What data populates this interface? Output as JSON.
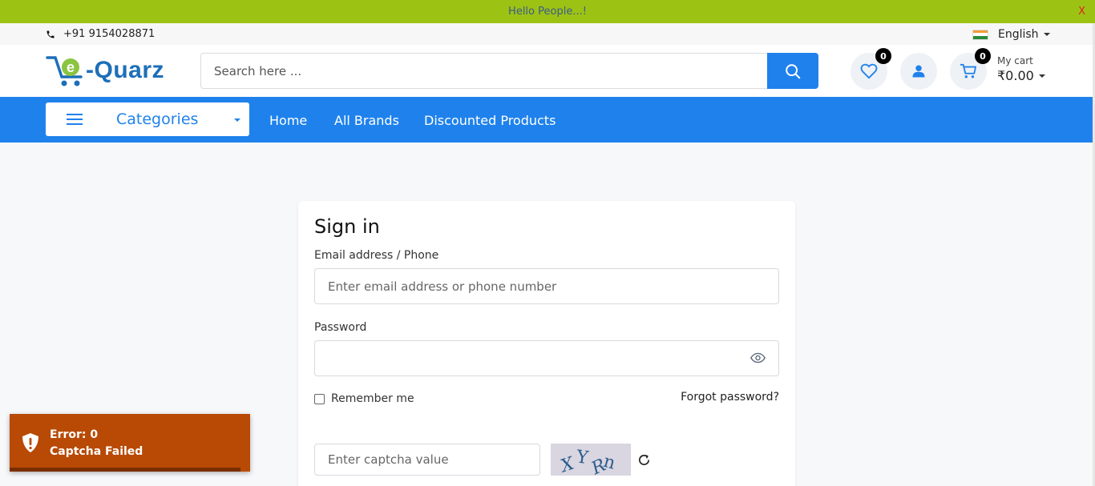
{
  "announcement": {
    "text": "Hello People...!",
    "close": "X"
  },
  "topbar": {
    "phone": "+91 9154028871",
    "language": "English"
  },
  "header": {
    "logo": {
      "text": "-Quarz",
      "letter": "e"
    },
    "search": {
      "placeholder": "Search here ..."
    },
    "wishlist": {
      "count": "0"
    },
    "cart": {
      "count": "0",
      "label": "My cart",
      "amount": "₹0.00"
    }
  },
  "nav": {
    "categories": "Categories",
    "links": [
      "Home",
      "All Brands",
      "Discounted Products"
    ]
  },
  "signin": {
    "title": "Sign in",
    "email_label": "Email address / Phone",
    "email_placeholder": "Enter email address or phone number",
    "password_label": "Password",
    "remember": "Remember me",
    "forgot": "Forgot password?",
    "captcha_placeholder": "Enter captcha value",
    "captcha_text": "XYRn"
  },
  "toast": {
    "title": "Error: 0",
    "message": "Captcha Failed",
    "progress": 0.96
  },
  "colors": {
    "accent": "#1f82ec",
    "announce_bg": "#9cc314",
    "toast_bg": "#b84a05"
  }
}
